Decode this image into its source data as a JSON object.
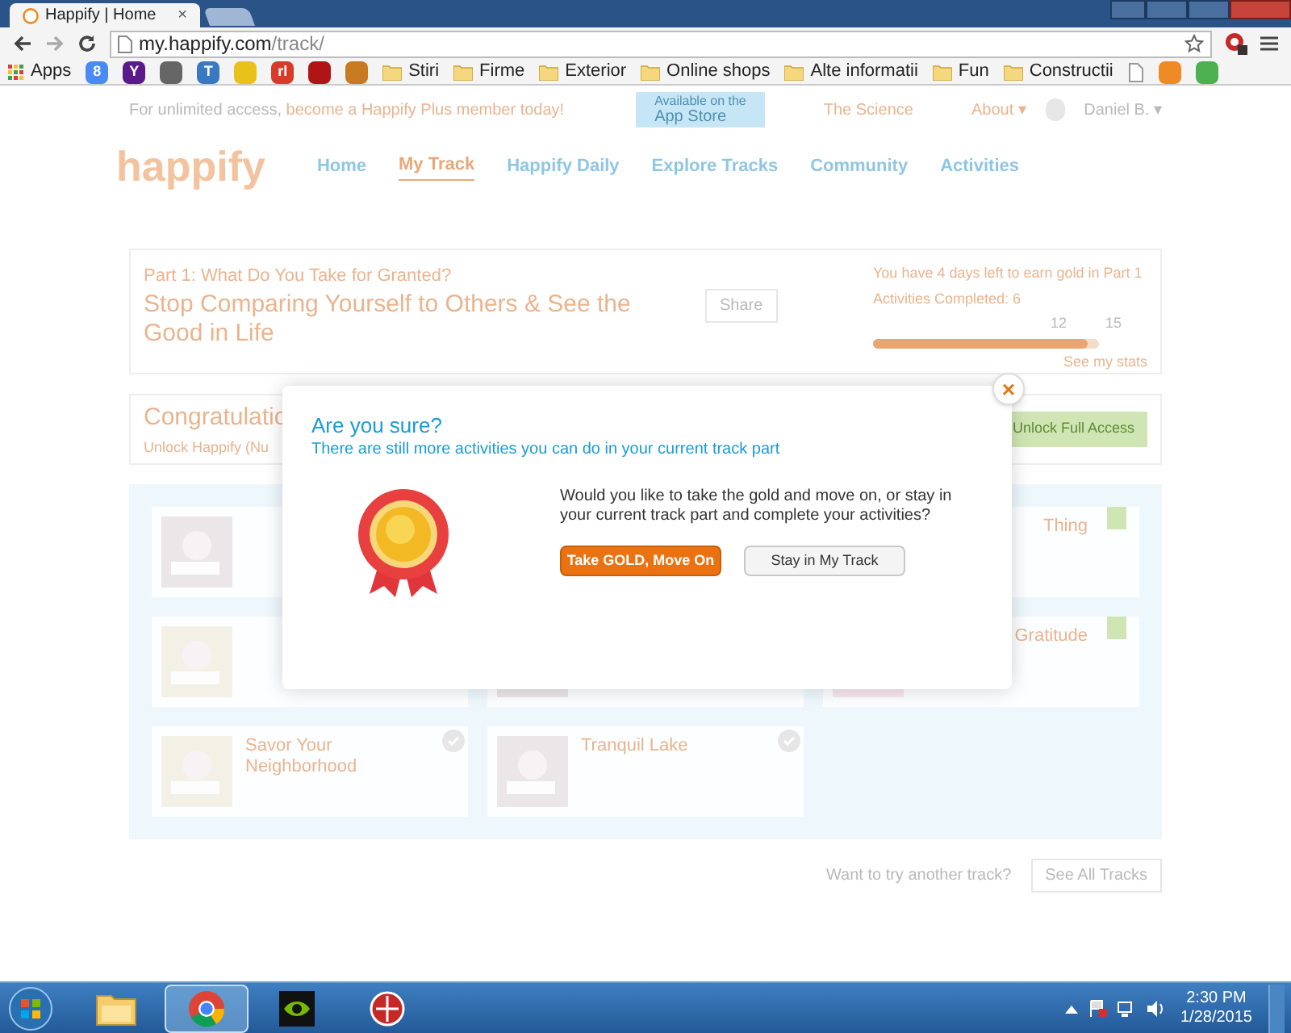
{
  "browser": {
    "tab_title": "Happify | Home",
    "tab_close": "×",
    "url_host": "my.happify.com",
    "url_path": "/track/",
    "bookmarks": [
      {
        "kind": "apps",
        "label": "Apps"
      },
      {
        "kind": "icon",
        "label": "8",
        "color": "#4a8af4"
      },
      {
        "kind": "icon",
        "label": "Y",
        "color": "#5b1a8c"
      },
      {
        "kind": "icon",
        "color": "#666666"
      },
      {
        "kind": "icon",
        "label": "T",
        "color": "#3a78c2"
      },
      {
        "kind": "icon",
        "color": "#e8c21a"
      },
      {
        "kind": "icon",
        "label": "rl",
        "color": "#d93b2b"
      },
      {
        "kind": "icon",
        "color": "#b01515"
      },
      {
        "kind": "icon",
        "color": "#c77a1f"
      },
      {
        "kind": "folder",
        "label": "Stiri"
      },
      {
        "kind": "folder",
        "label": "Firme"
      },
      {
        "kind": "folder",
        "label": "Exterior"
      },
      {
        "kind": "folder",
        "label": "Online shops"
      },
      {
        "kind": "folder",
        "label": "Alte informatii"
      },
      {
        "kind": "folder",
        "label": "Fun"
      },
      {
        "kind": "folder",
        "label": "Constructii"
      },
      {
        "kind": "page"
      },
      {
        "kind": "icon",
        "color": "#f08a24"
      },
      {
        "kind": "icon",
        "color": "#4caf50"
      }
    ]
  },
  "page": {
    "promo": "For unlimited access,",
    "promo_link": "become a Happify Plus member today!",
    "app_store_small": "Available on the",
    "app_store": "App Store",
    "top_links": [
      "The Science",
      "About ▾"
    ],
    "user": "Daniel B. ▾",
    "logo": "happify",
    "nav": [
      {
        "label": "Home",
        "selected": false
      },
      {
        "label": "My Track",
        "selected": true
      },
      {
        "label": "Happify Daily",
        "selected": false
      },
      {
        "label": "Explore Tracks",
        "selected": false
      },
      {
        "label": "Community",
        "selected": false
      },
      {
        "label": "Activities",
        "selected": false
      }
    ],
    "part_label": "Part 1: What Do You Take for Granted?",
    "part_title": "Stop Comparing Yourself to Others & See the Good in Life",
    "share": "Share",
    "gold_note": "You have 4 days left to earn gold in Part 1",
    "completed": "Activities Completed: 6",
    "progress": {
      "level": 0.95
    },
    "progress_ticks": [
      "12",
      "15"
    ],
    "stats_link": "See my stats",
    "congrats": "Congratulatio",
    "unlock_note": "Unlock Happify (Nu",
    "unlock_button": "Unlock Full Access",
    "cards": [
      {
        "picture": true,
        "star": false,
        "check": false
      },
      {
        "title": "Thing",
        "picture": false,
        "star": true,
        "check": false
      },
      {
        "picture": true,
        "star": false,
        "check": false
      },
      {
        "picture": true,
        "star": false,
        "check": false
      },
      {
        "title": "Gratitude",
        "picture": true,
        "star": true,
        "check": false
      },
      {
        "title": "Savor Your Neighborhood",
        "picture": true,
        "star": false,
        "check": true
      },
      {
        "title": "Tranquil Lake",
        "picture": true,
        "star": false,
        "check": true
      }
    ],
    "another": "Want to try another track?",
    "see_all": "See All Tracks"
  },
  "modal": {
    "title": "Are you sure?",
    "subtitle": "There are still more activities you can do in your current track part",
    "question": "Would you like to take the gold and move on, or stay in your current track part and complete your activities?",
    "primary": "Take GOLD, Move On",
    "secondary": "Stay in My Track",
    "close": "×"
  },
  "taskbar": {
    "apps": [
      {
        "kind": "explorer",
        "selected": false
      },
      {
        "kind": "chrome",
        "selected": true
      },
      {
        "kind": "nvidia",
        "selected": false
      },
      {
        "kind": "other",
        "selected": false
      }
    ],
    "time": "2:30 PM",
    "date": "1/28/2015"
  }
}
